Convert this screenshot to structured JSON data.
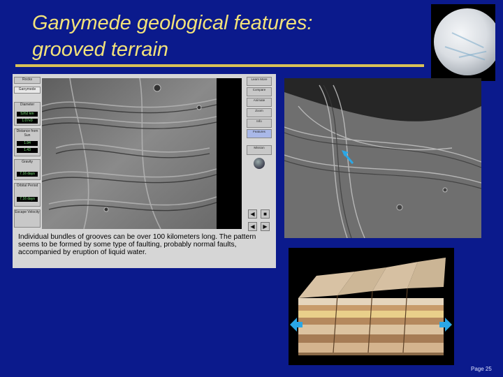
{
  "slide": {
    "title_line1": "Ganymede geological features:",
    "title_line2": "grooved terrain",
    "page": "Page 25"
  },
  "panel": {
    "sidebar": {
      "items": [
        "Rocks",
        "Ganymede",
        "Diameter",
        "Distance from Sun",
        "Density",
        "Gravity",
        "Rotation Period",
        "Orbital Period",
        "Escape Velocity"
      ],
      "values": [
        "5262 km",
        "1.07e9",
        "1.94",
        "1.43",
        "7.16 days",
        "7.16 days"
      ]
    },
    "right_buttons": [
      "Learn More",
      "Compare",
      "Animate",
      "Zoom",
      "Info",
      "Features",
      "Mission"
    ],
    "controls": [
      "◀",
      "■",
      "◀",
      "▶"
    ],
    "caption": "Individual bundles of grooves can be over 100 kilometers long. The pattern seems to be formed by some type of faulting, probably normal faults, accompanied by eruption of liquid water."
  },
  "colors": {
    "background": "#0b1a8c",
    "title": "#f2e27a",
    "rule": "#d9c257",
    "arrow": "#2aa7e6"
  }
}
